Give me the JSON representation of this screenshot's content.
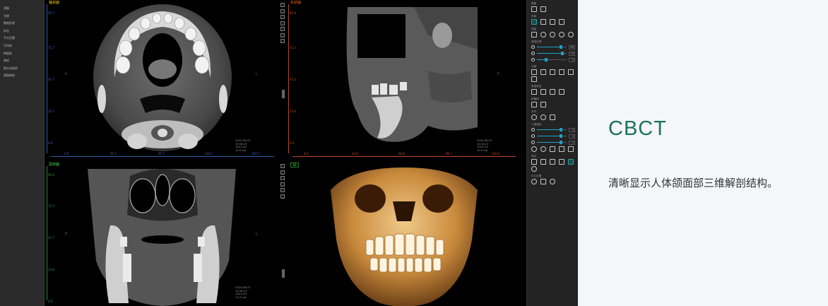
{
  "heading": "CBCT",
  "description": "清晰显示人体颌面部三维解剖结构。",
  "left_menu": {
    "items": [
      "测量",
      "注释",
      "数据处理",
      "标志",
      "平分位置",
      "牙科体",
      "种植体",
      "神经",
      "侧方向面积",
      "颌面神经"
    ]
  },
  "viewports": {
    "axial": {
      "title": "轴状面",
      "left_ticks": [
        "95.7",
        "71.7",
        "47.7",
        "23.7",
        "0.0"
      ],
      "bottom_ticks": [
        "0.0",
        "55.1",
        "95.7",
        "143.7",
        "191.7"
      ],
      "orient_left": "R",
      "orient_right": "L",
      "info": [
        "2023-06-03",
        "10:16:23",
        "100.0 kV",
        "10.0 mA"
      ]
    },
    "sagittal": {
      "title": "矢状面",
      "left_ticks": [
        "95.6",
        "71.3",
        "47.2",
        "23.6",
        "0.0"
      ],
      "bottom_ticks": [
        "0.0",
        "24.9",
        "59.6",
        "96.7",
        "120.4"
      ],
      "orient_right": "P",
      "info": [
        "2023-06-03",
        "10:16:23",
        "100.0 kV",
        "10.0 mA"
      ]
    },
    "coronal": {
      "title": "冠状面",
      "left_ticks": [
        "95.4",
        "71.5",
        "47.7",
        "23.8",
        "0.0"
      ],
      "orient_left": "R",
      "orient_right": "L",
      "info": [
        "2023-06-03",
        "10:16:23",
        "100.0 kV",
        "10.0 mA"
      ]
    },
    "volume": {
      "tag": "3D"
    }
  },
  "tool_panel": {
    "sections": [
      "图像",
      "布局",
      "测量",
      "渲染处理",
      "注释",
      "其他标定",
      "种植体",
      "牙列",
      "三维渲染",
      "导出",
      "中心位置"
    ],
    "sliders_top": [
      {
        "value": "60",
        "level": 0.8
      },
      {
        "value": "73",
        "level": 0.85
      },
      {
        "value": "0",
        "level": 0.3
      }
    ],
    "sliders_bottom": [
      {
        "value": "0",
        "level": 0.8
      },
      {
        "value": "0",
        "level": 0.8
      },
      {
        "value": "0",
        "level": 0.8
      }
    ]
  },
  "colors": {
    "heading": "#1a7358",
    "accent": "#1ea0c8"
  }
}
